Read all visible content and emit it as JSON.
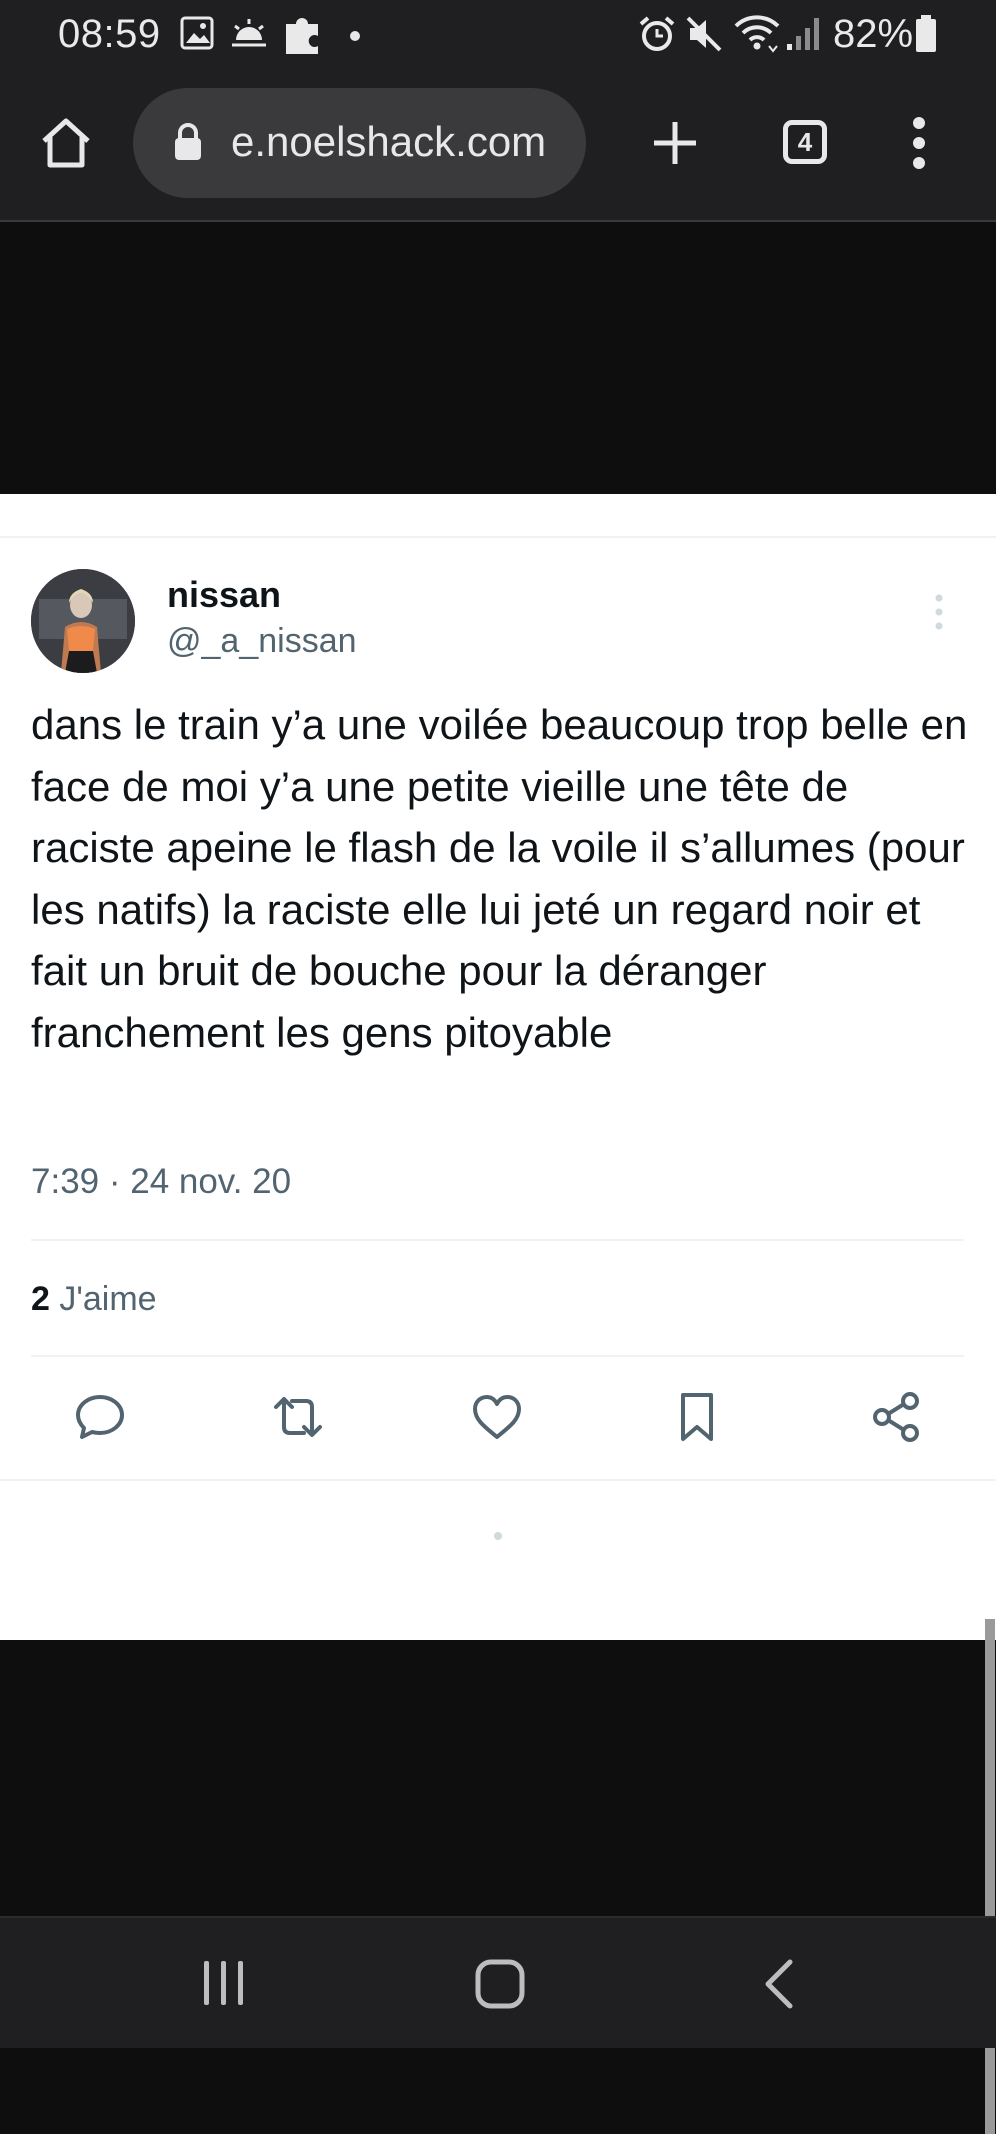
{
  "status_bar": {
    "time": "08:59",
    "left_icons": [
      "image-icon",
      "weather-icon",
      "puzzle-icon",
      "dot-icon"
    ],
    "right_icons": [
      "alarm-icon",
      "mute-icon",
      "wifi-icon",
      "signal-icon",
      "battery-icon"
    ],
    "battery": "82%"
  },
  "browser": {
    "url": "e.noelshack.com",
    "tab_count": "4",
    "icons": [
      "home-icon",
      "lock-icon",
      "plus-icon",
      "tabs-icon",
      "menu-icon"
    ]
  },
  "tweet": {
    "display_name": "nissan",
    "handle": "@_a_nissan",
    "text": "dans le train y’a une voilée beaucoup trop belle en face de moi y’a une petite vieille une tête de raciste apeine le flash de la voile il s’allumes (pour les natifs) la raciste elle lui jeté un regard noir et fait un bruit de bouche pour la déranger franchement les gens pitoyable",
    "timestamp": "7:39 · 24 nov. 20",
    "likes_count": "2",
    "likes_label": "J'aime",
    "actions": [
      "reply-icon",
      "retweet-icon",
      "like-icon",
      "bookmark-icon",
      "share-icon"
    ]
  },
  "nav": {
    "icons": [
      "recents-icon",
      "home-button-icon",
      "back-icon"
    ]
  },
  "colors": {
    "system_bar": "#1f1f21",
    "page_dark": "#0e0e0f",
    "text_primary": "#0f1419",
    "text_secondary": "#536471",
    "icon_gray": "#536471"
  }
}
